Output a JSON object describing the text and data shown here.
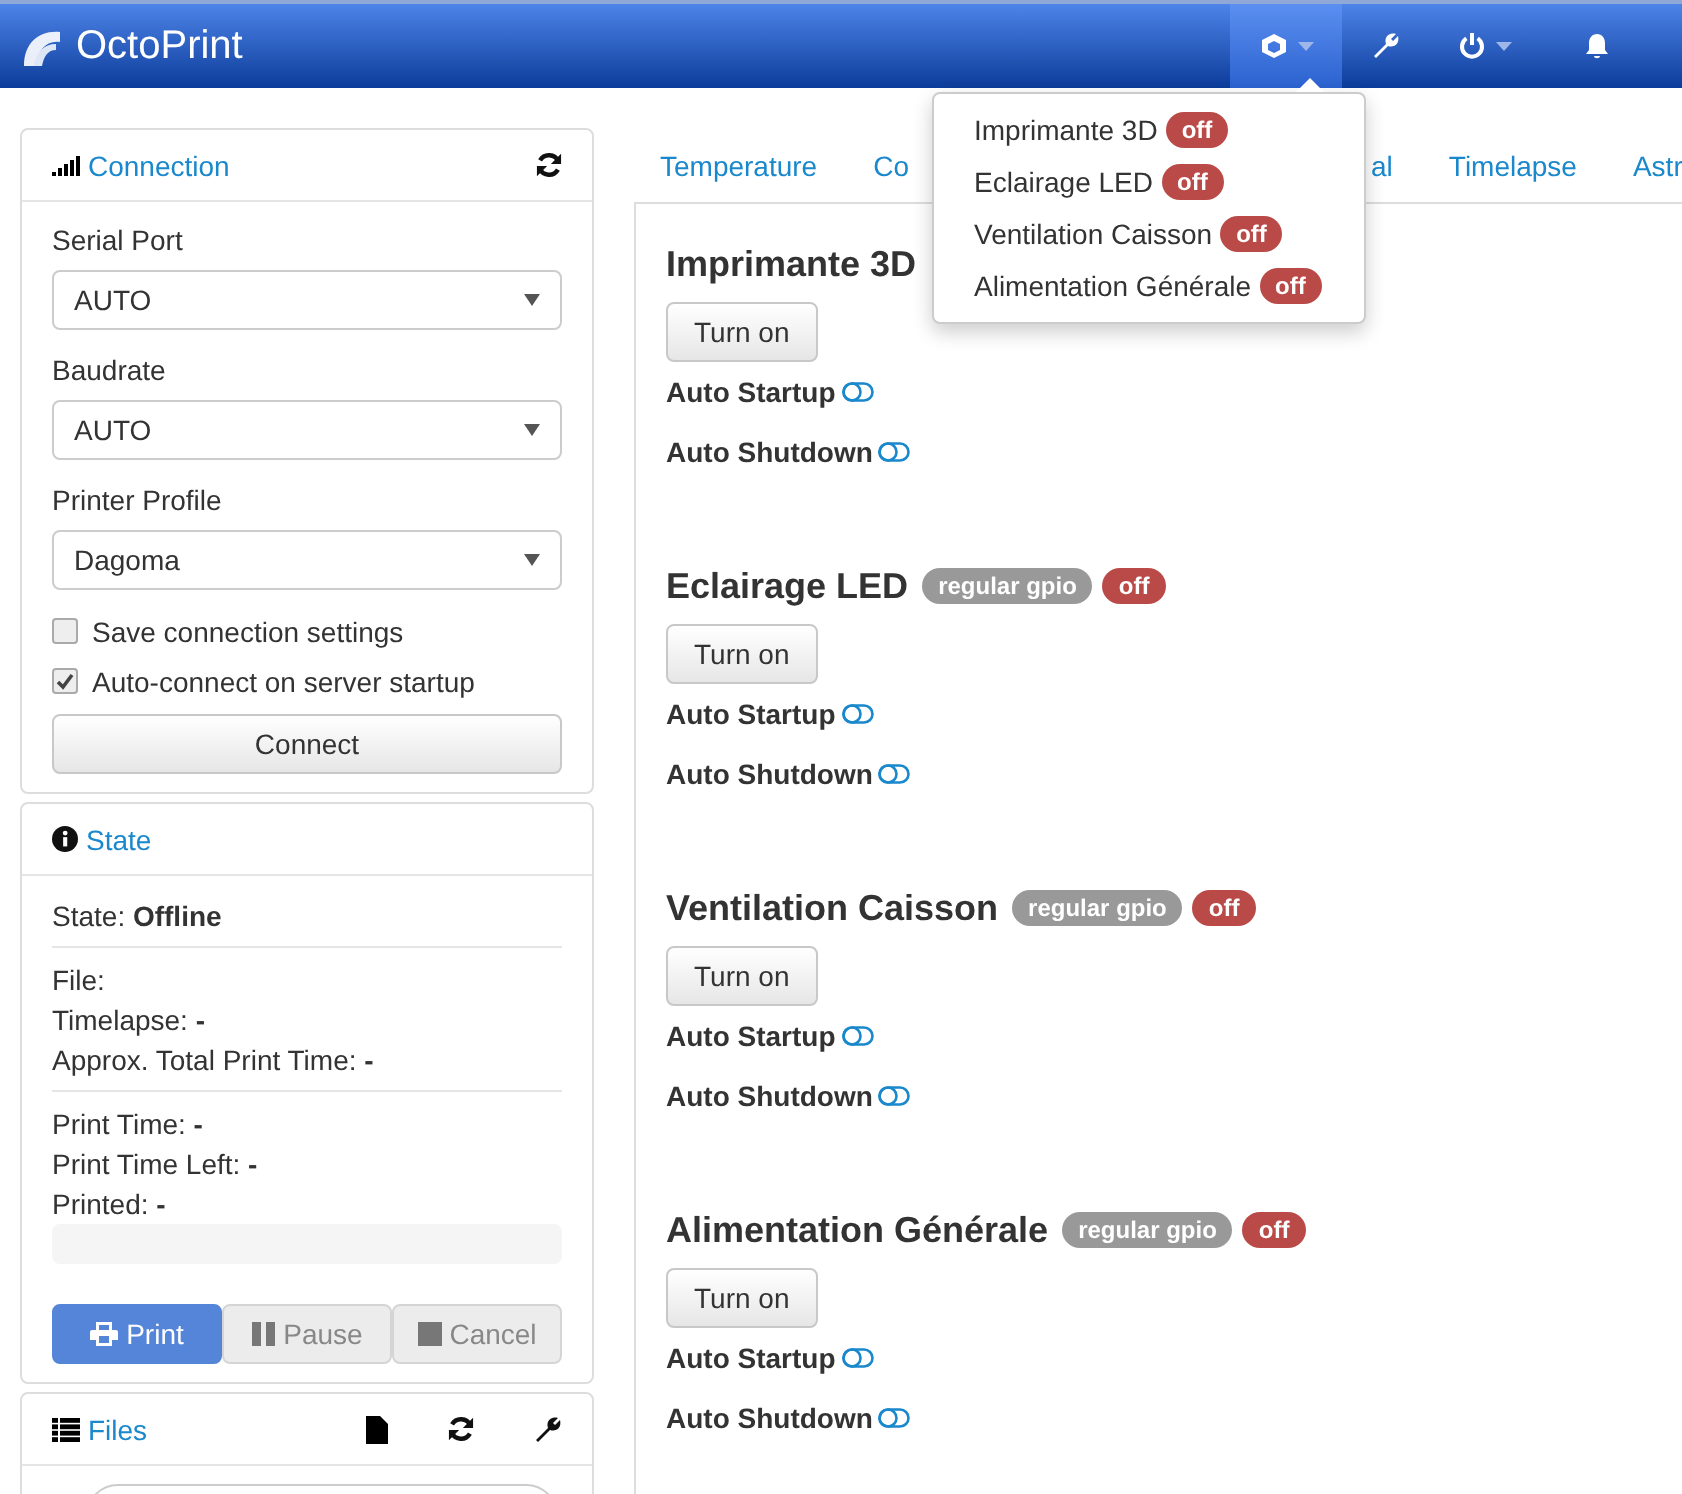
{
  "navbar": {
    "brand": "OctoPrint",
    "items": [
      {
        "kind": "psu",
        "selected": true,
        "caret": true
      },
      {
        "kind": "settings",
        "selected": false,
        "caret": false
      },
      {
        "kind": "power",
        "selected": false,
        "caret": true
      },
      {
        "kind": "notifications",
        "selected": false,
        "caret": false
      }
    ]
  },
  "psu_menu": [
    {
      "label": "Imprimante 3D",
      "state": "off",
      "color": "#b94a48"
    },
    {
      "label": "Eclairage LED",
      "state": "off",
      "color": "#b94a48"
    },
    {
      "label": "Ventilation Caisson",
      "state": "off",
      "color": "#b94a48"
    },
    {
      "label": "Alimentation Générale",
      "state": "off",
      "color": "#b94a48"
    }
  ],
  "connection": {
    "title": "Connection",
    "fields": [
      {
        "label": "Serial Port",
        "value": "AUTO"
      },
      {
        "label": "Baudrate",
        "value": "AUTO"
      },
      {
        "label": "Printer Profile",
        "value": "Dagoma"
      }
    ],
    "options": [
      {
        "label": "Save connection settings",
        "checked": false
      },
      {
        "label": "Auto-connect on server startup",
        "checked": true
      }
    ],
    "button": "Connect"
  },
  "state": {
    "title": "State",
    "groups": [
      [
        "State: **Offline**"
      ],
      [
        "File:",
        "Timelapse: **-**",
        "Approx. Total Print Time: **-**"
      ],
      [
        "Print Time: **-**",
        "Print Time Left: **-**",
        "Printed: **-**"
      ]
    ],
    "progress": {
      "level": 0
    },
    "buttons": [
      {
        "kind": "print",
        "label": "Print",
        "disabled": false
      },
      {
        "kind": "pause",
        "label": "Pause",
        "disabled": true
      },
      {
        "kind": "cancel",
        "label": "Cancel",
        "disabled": true
      }
    ]
  },
  "files": {
    "title": "Files"
  },
  "tabs": [
    {
      "label": "Temperature"
    },
    {
      "label": "Co"
    },
    {
      "label": "al"
    },
    {
      "label": "Timelapse"
    },
    {
      "label": "Astr"
    }
  ],
  "switches": [
    {
      "name": "Imprimante 3D",
      "button": "Turn on",
      "toggles": [
        "Auto Startup",
        "Auto Shutdown"
      ]
    },
    {
      "name": "Eclairage LED",
      "badges": [
        {
          "text": "regular gpio",
          "color": "#999999"
        },
        {
          "text": "off",
          "color": "#b94a48"
        }
      ],
      "button": "Turn on",
      "toggles": [
        "Auto Startup",
        "Auto Shutdown"
      ]
    },
    {
      "name": "Ventilation Caisson",
      "badges": [
        {
          "text": "regular gpio",
          "color": "#999999"
        },
        {
          "text": "off",
          "color": "#b94a48"
        }
      ],
      "button": "Turn on",
      "toggles": [
        "Auto Startup",
        "Auto Shutdown"
      ]
    },
    {
      "name": "Alimentation Générale",
      "badges": [
        {
          "text": "regular gpio",
          "color": "#999999"
        },
        {
          "text": "off",
          "color": "#b94a48"
        }
      ],
      "button": "Turn on",
      "toggles": [
        "Auto Startup",
        "Auto Shutdown"
      ]
    }
  ]
}
